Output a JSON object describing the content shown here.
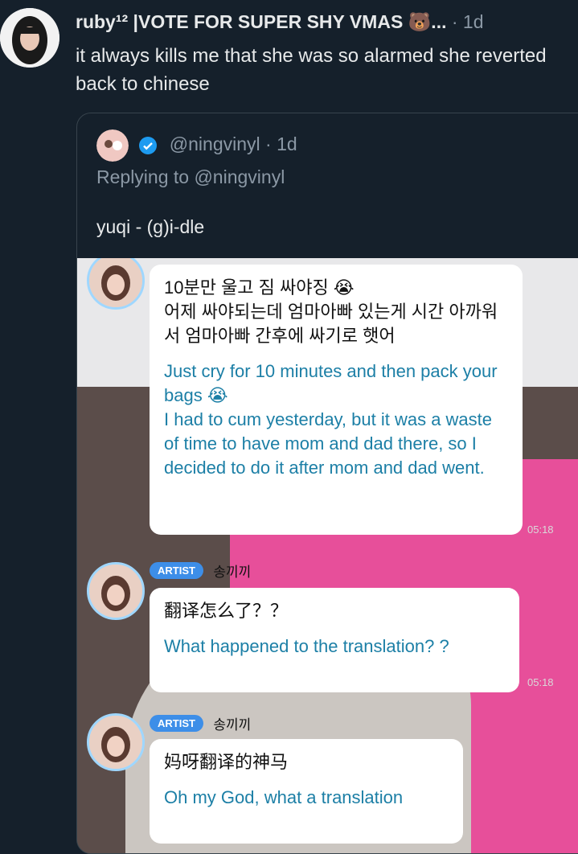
{
  "tweet": {
    "author": "ruby¹² |VOTE FOR SUPER SHY VMAS 🐻...",
    "time": "· 1d",
    "text": "it always kills me that she was so alarmed she reverted back to chinese"
  },
  "quote": {
    "handle": "@ningvinyl · 1d",
    "replying": "Replying to @ningvinyl",
    "text": "yuqi - (g)i-dle"
  },
  "chat": {
    "msg1": {
      "korean_line1": "10분만 울고 짐 싸야징 😭",
      "korean_line2": "어제 싸야되는데 엄마아빠 있는게 시간 아까워서 엄마아빠 간후에 싸기로 햇어",
      "translation_line1": "Just cry for 10 minutes and then pack your bags 😭",
      "translation_line2": "I had to cum yesterday, but it was a waste of time to have mom and dad there, so I decided to do it after mom and dad went."
    },
    "timestamp1": "05:18",
    "artist_badge": "ARTIST",
    "artist_name": "송끼끼",
    "msg2": {
      "original": "翻译怎么了？？",
      "translation": "What happened to the translation? ?"
    },
    "timestamp2": "05:18",
    "msg3": {
      "original": "妈呀翻译的神马",
      "translation": "Oh my God, what a translation"
    }
  },
  "colors": {
    "background": "#15202b",
    "muted_text": "#8b98a5",
    "translation_text": "#1c7fa6",
    "artist_badge": "#3d8ee8",
    "verified": "#1d9bf0"
  }
}
